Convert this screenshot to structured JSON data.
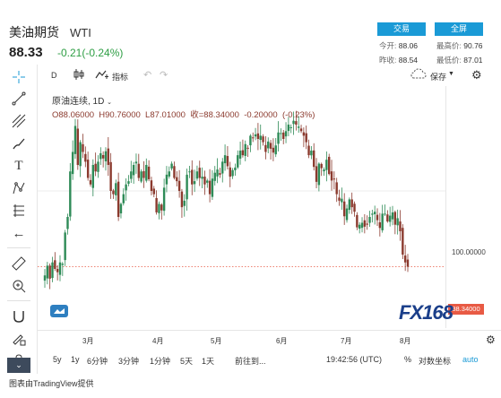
{
  "header": {
    "name": "美油期货",
    "symbol": "WTI",
    "price": "88.33",
    "change": "-0.21(-0.24%)",
    "trade_label": "交易",
    "fullscreen_label": "全屏"
  },
  "quote": {
    "open_label": "今开:",
    "open": "88.06",
    "high_label": "最高价:",
    "high": "90.76",
    "prev_close_label": "昨收:",
    "prev_close": "88.54",
    "low_label": "最低价:",
    "low": "87.01"
  },
  "toolbar": {
    "interval": "D",
    "indicators_label": "指标",
    "save_label": "保存"
  },
  "legend": {
    "series_name": "原油连续, 1D",
    "ohlc": "O88.06000  H90.76000  L87.01000  收=88.34000  -0.20000  (-0.23%)"
  },
  "axis": {
    "price_tick": "100.00000",
    "current_price": "88.34000",
    "months": [
      "3月",
      "4月",
      "5月",
      "6月",
      "7月",
      "8月"
    ]
  },
  "watermark": "FX168",
  "bottom_bar": {
    "ranges": [
      "5y",
      "1y",
      "6分钟",
      "3分钟",
      "1分钟",
      "5天",
      "1天"
    ],
    "goto_label": "前往到...",
    "time": "19:42:56 (UTC)",
    "percent_label": "%",
    "log_label": "对数坐标",
    "auto_label": "auto"
  },
  "footer": {
    "credit": "图表由TradingView提供"
  },
  "chart_data": {
    "type": "candlestick",
    "ylim": [
      80,
      112
    ],
    "y_ticks": [
      100
    ],
    "current_price": 88.34,
    "up_color": "#2e8b57",
    "down_color": "#8b3a2e",
    "closes": [
      87,
      88.5,
      86.5,
      89,
      88,
      87.5,
      89,
      88.8,
      93.6,
      96,
      103,
      106,
      110,
      104,
      107.5,
      106,
      104.5,
      102,
      101,
      104,
      103,
      104.5,
      105.8,
      105,
      106.1,
      104,
      100,
      99.5,
      101.2,
      96,
      98,
      99.5,
      101,
      101.5,
      103,
      104,
      104.5,
      102,
      103,
      102,
      104,
      101.8,
      100,
      99.5,
      96.7,
      98,
      97,
      100.5,
      102.5,
      103,
      104.2,
      102,
      101.5,
      100,
      97.5,
      98.5,
      102.5,
      103,
      101,
      101.5,
      103,
      102,
      102.2,
      101,
      101.6,
      99.5,
      101.9,
      102.8,
      103.3,
      102.5,
      104.5,
      105.5,
      103.8,
      102.2,
      103.2,
      103.6,
      105.5,
      106.2,
      105.5,
      107.2,
      106.6,
      108.5,
      108.1,
      108.7,
      108,
      108.5,
      107.5,
      106,
      107.6,
      106.5,
      105.9,
      107,
      109,
      108.9,
      108,
      109.2,
      110.2,
      109.8,
      110.8,
      110.2,
      109.9,
      109.2,
      108.5,
      107.5,
      105.5,
      106.2,
      103.7,
      101.4,
      104.2,
      103.5,
      103.3,
      104.8,
      102.6,
      101.6,
      101.9,
      99.5,
      98.5,
      98.8,
      96.1,
      97.3,
      98.7,
      97.5,
      96.8,
      94.4,
      94.8,
      95.1,
      94.5,
      94.8,
      96,
      96.5,
      96.8,
      95.5,
      94.3,
      96.5,
      96.5,
      95.3,
      96.2,
      96.7,
      94.8,
      95.8,
      93.8,
      90.2,
      89,
      88.34
    ]
  }
}
